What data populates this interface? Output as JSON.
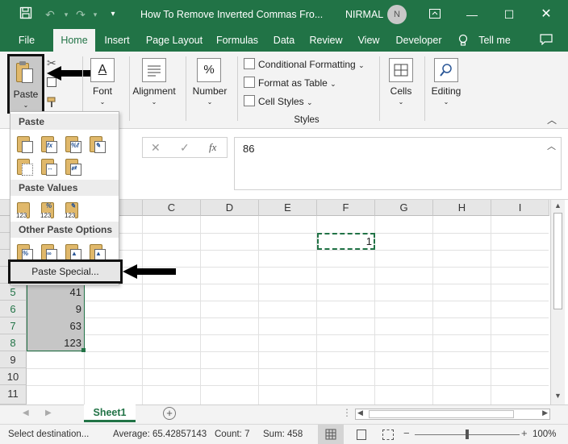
{
  "titlebar": {
    "title": "How To Remove Inverted Commas Fro...",
    "user": "NIRMAL",
    "avatar_letter": "N"
  },
  "menu": {
    "tabs": [
      "File",
      "Home",
      "Insert",
      "Page Layout",
      "Formulas",
      "Data",
      "Review",
      "View",
      "Developer"
    ],
    "active": "Home",
    "tell_me": "Tell me"
  },
  "ribbon": {
    "paste": "Paste",
    "font": "Font",
    "alignment": "Alignment",
    "number": "Number",
    "number_icon": "%",
    "conditional_formatting": "Conditional Formatting",
    "format_as_table": "Format as Table",
    "cell_styles": "Cell Styles",
    "styles_group": "Styles",
    "cells": "Cells",
    "editing": "Editing"
  },
  "formula_bar": {
    "fx": "fx",
    "value": "86"
  },
  "paste_menu": {
    "paste_header": "Paste",
    "values_header": "Paste Values",
    "other_header": "Other Paste Options",
    "paste_special": "Paste Special...",
    "values_icon_label": "123"
  },
  "grid": {
    "columns": [
      "C",
      "D",
      "E",
      "F",
      "G",
      "H",
      "I"
    ],
    "rows": [
      "5",
      "6",
      "7",
      "8",
      "9",
      "10",
      "11"
    ],
    "b_values": [
      "41",
      "9",
      "63",
      "123"
    ],
    "f_value": "1"
  },
  "sheets": {
    "active": "Sheet1"
  },
  "status": {
    "mode": "Select destination...",
    "average": "Average: 65.42857143",
    "count": "Count: 7",
    "sum": "Sum: 458",
    "zoom": "100%"
  },
  "colors": {
    "brand": "#217346",
    "selection": "#c6c6c6"
  }
}
